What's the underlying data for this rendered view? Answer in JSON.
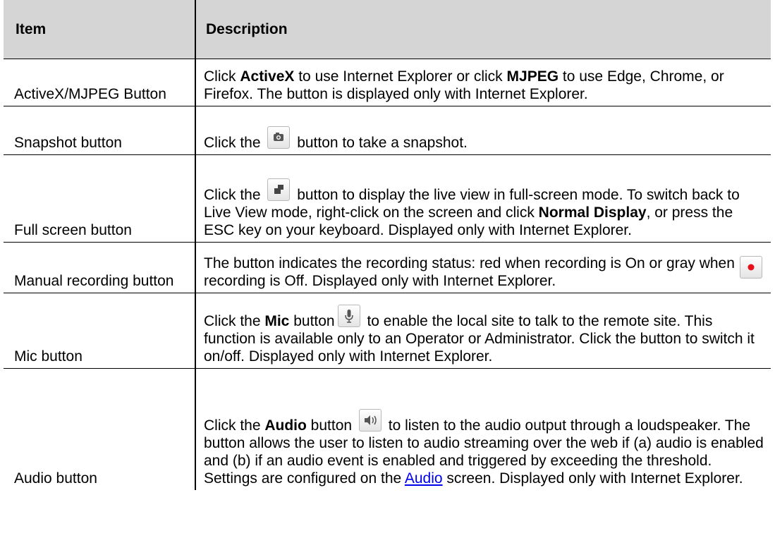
{
  "header": {
    "col_item": "Item",
    "col_desc": "Description"
  },
  "rows": [
    {
      "item": "ActiveX/MJPEG Button",
      "d1": "Click ",
      "b1": "ActiveX",
      "d2": " to use Internet Explorer or click ",
      "b2": "MJPEG",
      "d3": " to use Edge, Chrome, or Firefox. The button is displayed only with Internet Explorer."
    },
    {
      "item": "Snapshot button",
      "d1": "Click the ",
      "d2": " button to take a snapshot."
    },
    {
      "item": "Full screen button",
      "d1": "Click the ",
      "d2": " button to display the live view in full-screen mode. To switch back to Live View mode, right-click on the screen and click ",
      "b1": "Normal Display",
      "d3": ", or press the ESC key on your keyboard. Displayed only with Internet Explorer."
    },
    {
      "item": "Manual recording button",
      "d1": "The button indicates the recording status: red when recording is On or gray when recording is Off. Displayed only with Internet Explorer."
    },
    {
      "item": "Mic button",
      "d1": "Click the ",
      "b1": "Mic",
      "d2": " button",
      "d3": " to enable the local site to talk to the remote site. This function is available only to an Operator or Administrator. Click the button to switch it on/off. Displayed only with Internet Explorer."
    },
    {
      "item": "Audio button",
      "d1": "Click the ",
      "b1": "Audio",
      "d2": " button ",
      "d3": " to listen to the audio output through a loudspeaker. The button allows the user to listen to audio streaming over the web if (a) audio is enabled and (b) if an audio event is enabled and triggered by exceeding the threshold. Settings are configured on the ",
      "link": "Audio",
      "d4": " screen. Displayed only with Internet Explorer."
    }
  ],
  "icons": {
    "snapshot": "camera-icon",
    "fullscreen": "fullscreen-icon",
    "record": "record-icon",
    "mic": "mic-icon",
    "audio": "speaker-icon",
    "record_color": "#e8101a"
  }
}
